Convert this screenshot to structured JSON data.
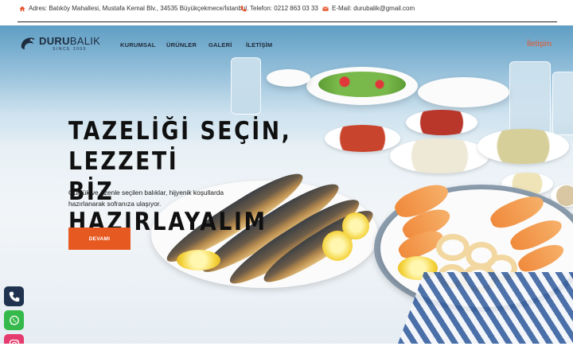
{
  "topbar": {
    "address": "Adres: Batıköy Mahallesi, Mustafa Kemal Blv., 34535 Büyükçekmece/İstanbul.",
    "phone": "Telefon: 0212 863 03 33",
    "email": "E-Mail: durubalik@gmail.com",
    "icon_color": "#e5542a"
  },
  "logo": {
    "name_bold": "DURU",
    "name_light": "BALIK",
    "since": "SINCE 2005"
  },
  "nav": {
    "items": [
      "KURUMSAL",
      "ÜRÜNLER",
      "GALERİ",
      "İLETİŞİM"
    ],
    "contact": "İletişim"
  },
  "hero": {
    "headline_line1": "TAZELİĞİ SEÇİN, LEZZETİ",
    "headline_line2": "BİZ HAZIRLAYALIM",
    "subtext_line1": "Günlük ve özenle seçilen balıklar, hijyenik koşullarda",
    "subtext_line2": "hazırlanarak sofranıza ulaşıyor.",
    "cta_label": "DEVAMI",
    "cta_color": "#e65a22"
  },
  "social": [
    "phone-icon",
    "whatsapp-icon",
    "instagram-icon"
  ]
}
